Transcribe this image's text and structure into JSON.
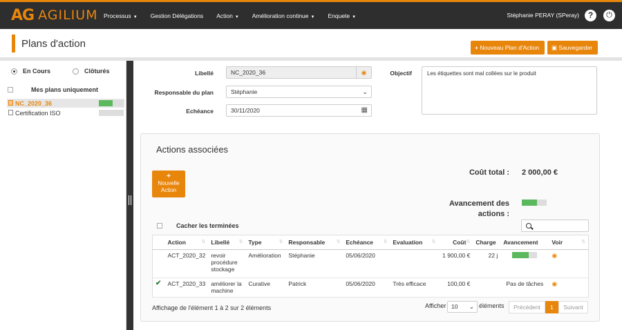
{
  "logo": {
    "mark": "AG",
    "name": "AGILIUM"
  },
  "nav": {
    "items": [
      "Processus",
      "Gestion Délégations",
      "Action",
      "Amélioration continue",
      "Enquete"
    ],
    "has_caret": [
      true,
      false,
      true,
      true,
      true
    ],
    "user": "Stéphanie PERAY (SPeray)",
    "help": "?",
    "power": "⏻"
  },
  "header": {
    "title": "Plans d'action",
    "new_plan_label": "Nouveau Plan d'Action",
    "save_label": "Sauvegarder"
  },
  "left": {
    "radio_en_cours": "En Cours",
    "radio_clotures": "Clôturés",
    "mes_plans": "Mes plans uniquement",
    "plans": [
      {
        "name": "NC_2020_36",
        "progress": 0.55,
        "selected": true
      },
      {
        "name": "Certification ISO",
        "progress": 0,
        "selected": false
      }
    ]
  },
  "form": {
    "libelle_label": "Libellé",
    "libelle_value": "NC_2020_36",
    "responsable_label": "Responsable du plan",
    "responsable_value": "Stéphanie",
    "echeance_label": "Echéance",
    "echeance_value": "30/11/2020",
    "objectif_label": "Objectif",
    "objectif_value": "Les étiquettes sont mal collées sur le produit"
  },
  "actions": {
    "title": "Actions associées",
    "new_action_plus": "+",
    "new_action_label": "Nouvelle Action",
    "cout_total_label": "Coût total :",
    "cout_total_value": "2 000,00 €",
    "avancement_label": "Avancement des actions :",
    "avancement_progress": 0.6,
    "hide_done_label": "Cacher les terminées",
    "columns": [
      "Action",
      "Libellé",
      "Type",
      "Responsable",
      "Echéance",
      "Evaluation",
      "Coût",
      "Charge",
      "Avancement",
      "Voir"
    ],
    "rows": [
      {
        "check": "",
        "action": "ACT_2020_32",
        "libelle": "revoir procédure stockage",
        "type": "Amélioration",
        "responsable": "Stéphanie",
        "echeance": "05/06/2020",
        "evaluation": "",
        "cout": "1 900,00 €",
        "charge": "22 j",
        "avancement": "",
        "progress": 0.65
      },
      {
        "check": "✔",
        "action": "ACT_2020_33",
        "libelle": "améliorer la machine",
        "type": "Curative",
        "responsable": "Patrick",
        "echeance": "05/06/2020",
        "evaluation": "Très efficace",
        "cout": "100,00 €",
        "charge": "",
        "avancement": "Pas de tâches",
        "progress": null
      }
    ],
    "footer_info": "Affichage de l'élément 1 à 2 sur 2 éléments",
    "afficher_label": "Afficher",
    "page_size": "10",
    "elements_label": "éléments",
    "prev_label": "Précédent",
    "page_current": "1",
    "next_label": "Suivant"
  },
  "colors": {
    "accent": "#e8860c",
    "progress": "#5cb85c",
    "topbar": "#2e2e2e"
  }
}
